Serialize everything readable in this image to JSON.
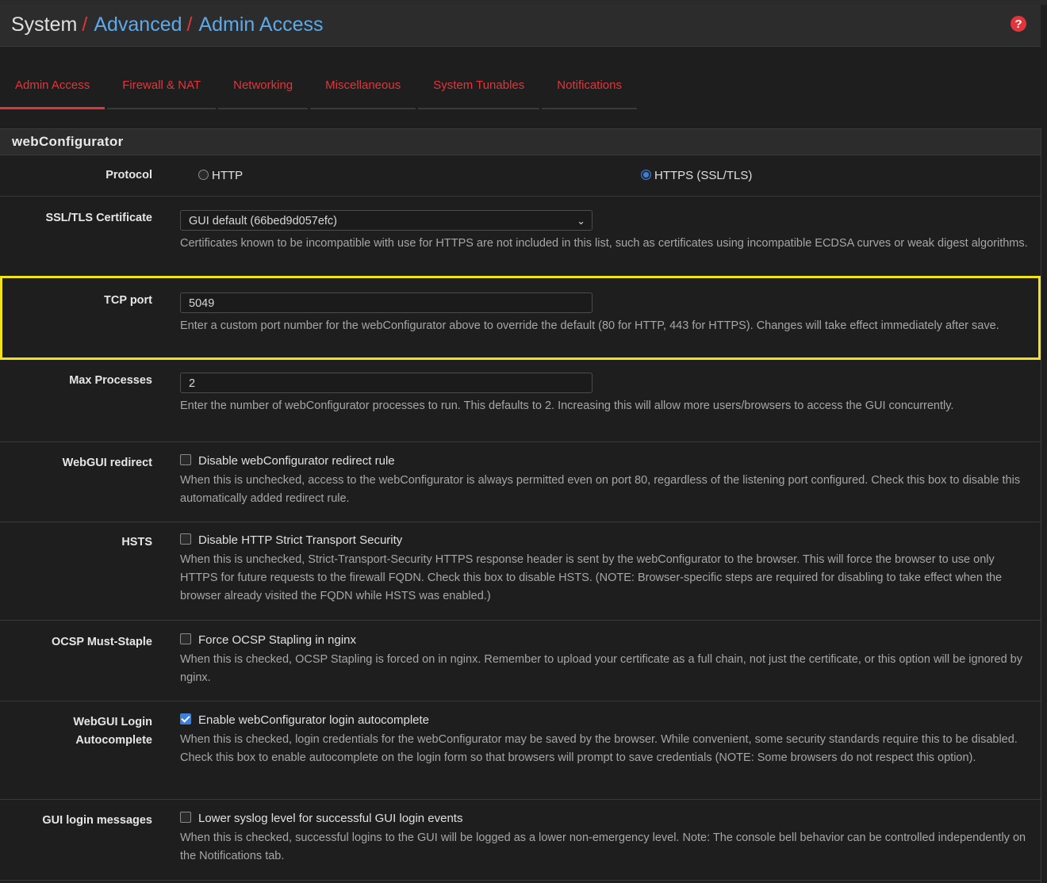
{
  "breadcrumb": {
    "root": "System",
    "sep": "/",
    "middle": "Advanced",
    "current": "Admin Access"
  },
  "help_icon": "question-circle-icon",
  "tabs": [
    "Admin Access",
    "Firewall & NAT",
    "Networking",
    "Miscellaneous",
    "System Tunables",
    "Notifications"
  ],
  "active_tab": "Admin Access",
  "section_title": "webConfigurator",
  "protocol": {
    "label": "Protocol",
    "options": [
      "HTTP",
      "HTTPS (SSL/TLS)"
    ],
    "selected": "HTTPS (SSL/TLS)"
  },
  "certificate": {
    "label": "SSL/TLS Certificate",
    "value": "GUI default (66bed9d057efc)",
    "help": "Certificates known to be incompatible with use for HTTPS are not included in this list, such as certificates using incompatible ECDSA curves or weak digest algorithms."
  },
  "tcp_port": {
    "label": "TCP port",
    "value": "5049",
    "help": "Enter a custom port number for the webConfigurator above to override the default (80 for HTTP, 443 for HTTPS). Changes will take effect immediately after save."
  },
  "max_processes": {
    "label": "Max Processes",
    "value": "2",
    "help": "Enter the number of webConfigurator processes to run. This defaults to 2. Increasing this will allow more users/browsers to access the GUI concurrently."
  },
  "webgui_redirect": {
    "label": "WebGUI redirect",
    "checkbox": "Disable webConfigurator redirect rule",
    "checked": false,
    "help": "When this is unchecked, access to the webConfigurator is always permitted even on port 80, regardless of the listening port configured. Check this box to disable this automatically added redirect rule."
  },
  "hsts": {
    "label": "HSTS",
    "checkbox": "Disable HTTP Strict Transport Security",
    "checked": false,
    "help": "When this is unchecked, Strict-Transport-Security HTTPS response header is sent by the webConfigurator to the browser. This will force the browser to use only HTTPS for future requests to the firewall FQDN. Check this box to disable HSTS. (NOTE: Browser-specific steps are required for disabling to take effect when the browser already visited the FQDN while HSTS was enabled.)"
  },
  "ocsp": {
    "label": "OCSP Must-Staple",
    "checkbox": "Force OCSP Stapling in nginx",
    "checked": false,
    "help": "When this is checked, OCSP Stapling is forced on in nginx. Remember to upload your certificate as a full chain, not just the certificate, or this option will be ignored by nginx."
  },
  "login_autocomplete": {
    "label_line1": "WebGUI Login",
    "label_line2": "Autocomplete",
    "checkbox": "Enable webConfigurator login autocomplete",
    "checked": true,
    "help": "When this is checked, login credentials for the webConfigurator may be saved by the browser. While convenient, some security standards require this to be disabled. Check this box to enable autocomplete on the login form so that browsers will prompt to save credentials (NOTE: Some browsers do not respect this option)."
  },
  "login_messages": {
    "label": "GUI login messages",
    "checkbox": "Lower syslog level for successful GUI login events",
    "checked": false,
    "help": "When this is checked, successful logins to the GUI will be logged as a lower non-emergency level. Note: The console bell behavior can be controlled independently on the Notifications tab."
  },
  "colors": {
    "accent": "#e2353b",
    "link": "#5da9e9",
    "highlight": "#f2e21a",
    "checked": "#3d7fd9"
  }
}
